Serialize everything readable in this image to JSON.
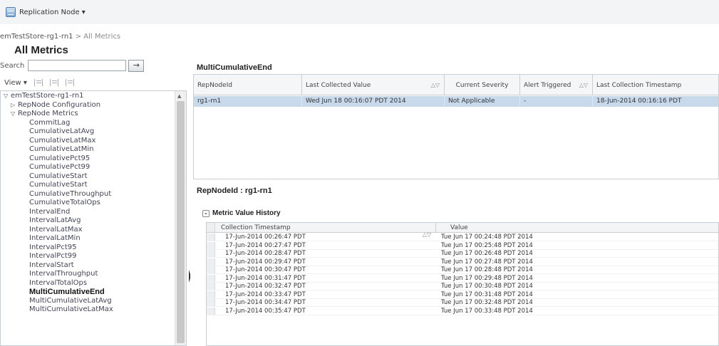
{
  "topbar": {
    "menu_label": "Replication Node ▾",
    "icon": "replication-node-icon"
  },
  "breadcrumb": {
    "root": "emTestStore-rg1-rn1",
    "separator": " > ",
    "current": "All Metrics"
  },
  "page_title": "All Metrics",
  "search": {
    "label": "Search",
    "value": "",
    "go": "→"
  },
  "tree_toolbar": {
    "view_label": "View ▾"
  },
  "tree": {
    "items": [
      {
        "label": "emTestStore-rg1-rn1",
        "twisty": "▽"
      },
      {
        "label": "RepNode Configuration",
        "twisty": "▷"
      },
      {
        "label": "RepNode Metrics",
        "twisty": "▽"
      },
      {
        "label": "CommitLag"
      },
      {
        "label": "CumulativeLatAvg"
      },
      {
        "label": "CumulativeLatMax"
      },
      {
        "label": "CumulativeLatMin"
      },
      {
        "label": "CumulativePct95"
      },
      {
        "label": "CumulativePct99"
      },
      {
        "label": "CumulativeStart"
      },
      {
        "label": "CumulativeStart"
      },
      {
        "label": "CumulativeThroughput"
      },
      {
        "label": "CumulativeTotalOps"
      },
      {
        "label": "IntervalEnd"
      },
      {
        "label": "IntervalLatAvg"
      },
      {
        "label": "IntervalLatMax"
      },
      {
        "label": "IntervalLatMin"
      },
      {
        "label": "IntervalPct95"
      },
      {
        "label": "IntervalPct99"
      },
      {
        "label": "IntervalStart"
      },
      {
        "label": "IntervalThroughput"
      },
      {
        "label": "IntervalTotalOps"
      },
      {
        "label": "MultiCumulativeEnd"
      },
      {
        "label": "MultiCumulativeLatAvg"
      },
      {
        "label": "MultiCumulativeLatMax"
      }
    ]
  },
  "metric_table": {
    "title": "MultiCumulativeEnd",
    "columns": [
      "RepNodeId",
      "Last Collected Value",
      "Current Severity",
      "Alert Triggered",
      "Last Collection Timestamp"
    ],
    "rows": [
      [
        "rg1-rn1",
        "Wed Jun 18 00:16:07 PDT 2014",
        "Not Applicable",
        "-",
        "18-Jun-2014 00:16:16 PDT"
      ]
    ]
  },
  "repnode": {
    "title": "RepNodeId : rg1-rn1"
  },
  "history": {
    "title": "Metric Value History",
    "columns": [
      "Collection Timestamp",
      "Value"
    ],
    "rows": [
      [
        "17-Jun-2014 00:26:47 PDT",
        "Tue Jun 17 00:24:48 PDT 2014"
      ],
      [
        "17-Jun-2014 00:27:47 PDT",
        "Tue Jun 17 00:25:48 PDT 2014"
      ],
      [
        "17-Jun-2014 00:28:47 PDT",
        "Tue Jun 17 00:26:48 PDT 2014"
      ],
      [
        "17-Jun-2014 00:29:47 PDT",
        "Tue Jun 17 00:27:48 PDT 2014"
      ],
      [
        "17-Jun-2014 00:30:47 PDT",
        "Tue Jun 17 00:28:48 PDT 2014"
      ],
      [
        "17-Jun-2014 00:31:47 PDT",
        "Tue Jun 17 00:29:48 PDT 2014"
      ],
      [
        "17-Jun-2014 00:32:47 PDT",
        "Tue Jun 17 00:30:48 PDT 2014"
      ],
      [
        "17-Jun-2014 00:33:47 PDT",
        "Tue Jun 17 00:31:48 PDT 2014"
      ],
      [
        "17-Jun-2014 00:34:47 PDT",
        "Tue Jun 17 00:32:48 PDT 2014"
      ],
      [
        "17-Jun-2014 00:35:47 PDT",
        "Tue Jun 17 00:33:48 PDT 2014"
      ]
    ]
  },
  "colors": {
    "selection": "#c9d9ec",
    "border": "#c9ced3",
    "header_bg": "#f5f6f7"
  }
}
